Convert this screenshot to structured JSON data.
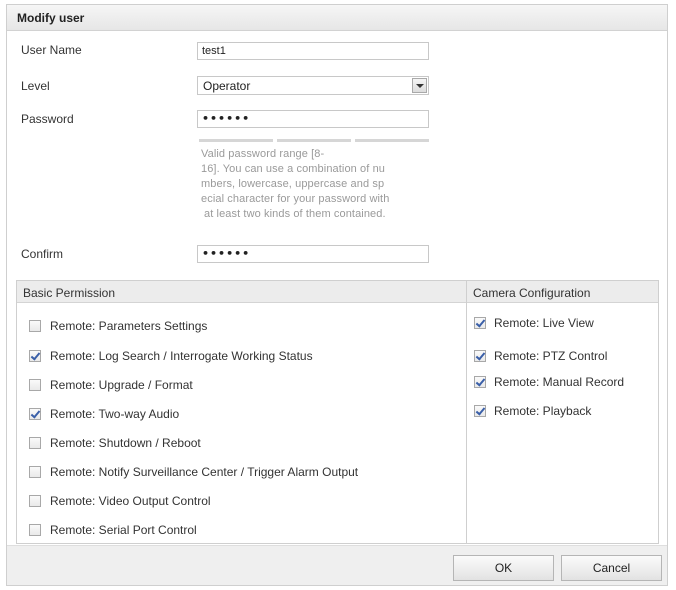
{
  "dialog": {
    "title": "Modify user"
  },
  "form": {
    "username_label": "User Name",
    "username_value": "test1",
    "level_label": "Level",
    "level_value": "Operator",
    "password_label": "Password",
    "password_value": "••••••",
    "password_hint_lines": [
      "Valid password range [8-",
      "16]. You can use a combination of nu",
      "mbers, lowercase, uppercase and sp",
      "ecial character for your password with",
      "at least two kinds of them contained."
    ],
    "confirm_label": "Confirm",
    "confirm_value": "••••••"
  },
  "permissions": {
    "basic_header": "Basic Permission",
    "camera_header": "Camera Configuration",
    "basic": [
      {
        "label": "Remote: Parameters Settings",
        "checked": false
      },
      {
        "label": "Remote: Log Search / Interrogate Working Status",
        "checked": true
      },
      {
        "label": "Remote: Upgrade / Format",
        "checked": false
      },
      {
        "label": "Remote: Two-way Audio",
        "checked": true
      },
      {
        "label": "Remote: Shutdown / Reboot",
        "checked": false
      },
      {
        "label": "Remote: Notify Surveillance Center / Trigger Alarm Output",
        "checked": false
      },
      {
        "label": "Remote: Video Output Control",
        "checked": false
      },
      {
        "label": "Remote: Serial Port Control",
        "checked": false
      }
    ],
    "camera": [
      {
        "label": "Remote: Live View",
        "checked": true
      },
      {
        "label": "Remote: PTZ Control",
        "checked": true
      },
      {
        "label": "Remote: Manual Record",
        "checked": true
      },
      {
        "label": "Remote: Playback",
        "checked": true
      }
    ]
  },
  "buttons": {
    "ok_label": "OK",
    "cancel_label": "Cancel"
  },
  "colors": {
    "check_mark": "#3a5fa8",
    "header_bg": "#ececec",
    "hint_text": "#9a9a9a"
  },
  "icons": {
    "dropdown": "chevron-down-icon",
    "checkbox": "checkbox-icon"
  }
}
